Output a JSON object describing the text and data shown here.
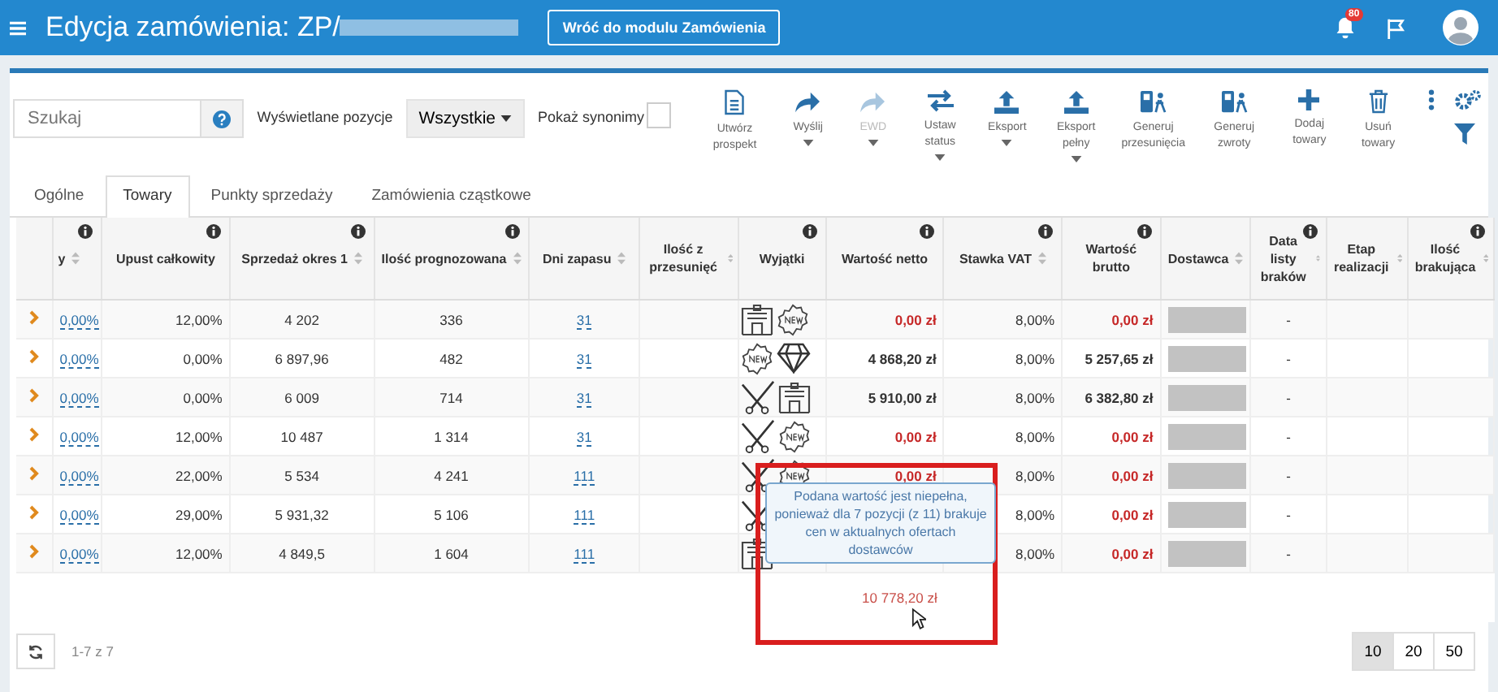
{
  "header": {
    "title": "Edycja zamówienia: ZP/",
    "back_button": "Wróć do modulu Zamówienia",
    "notification_count": "80"
  },
  "search": {
    "placeholder": "Szukaj"
  },
  "filter": {
    "label": "Wyświetlane pozycje",
    "value": "Wszystkie"
  },
  "synonyms": {
    "label": "Pokaż synonimy",
    "checked": false
  },
  "toolbar": [
    {
      "kind": "document",
      "label": "Utwórz prospekt",
      "disabled": false,
      "menu": false
    },
    {
      "kind": "forward",
      "label": "Wyślij",
      "disabled": false,
      "menu": true
    },
    {
      "kind": "forward",
      "label": "EWD",
      "disabled": true,
      "menu": true
    },
    {
      "kind": "swap",
      "label": "Ustaw status",
      "disabled": false,
      "menu": true
    },
    {
      "kind": "upload",
      "label": "Eksport",
      "disabled": false,
      "menu": true
    },
    {
      "kind": "upload",
      "label": "Eksport pełny",
      "disabled": false,
      "menu": true
    },
    {
      "kind": "transfer",
      "label": "Generuj przesunięcia",
      "disabled": false,
      "menu": false
    },
    {
      "kind": "transfer",
      "label": "Generuj zwroty",
      "disabled": false,
      "menu": false
    },
    {
      "kind": "plus",
      "label": "Dodaj towary",
      "disabled": false,
      "menu": false
    },
    {
      "kind": "trash",
      "label": "Usuń towary",
      "disabled": false,
      "menu": false
    }
  ],
  "tabs": [
    {
      "label": "Ogólne",
      "selected": false
    },
    {
      "label": "Towary",
      "selected": true
    },
    {
      "label": "Punkty sprzedaży",
      "selected": false
    },
    {
      "label": "Zamówienia cząstkowe",
      "selected": false
    }
  ],
  "table": {
    "columns": [
      {
        "info": false,
        "sort": false
      },
      {
        "label": "y",
        "info": true,
        "sort": true
      },
      {
        "label": "Upust całkowity",
        "info": true,
        "sort": false
      },
      {
        "label": "Sprzedaż okres 1",
        "info": true,
        "sort": true
      },
      {
        "label": "Ilość prognozowana",
        "info": true,
        "sort": true
      },
      {
        "label": "Dni zapasu",
        "info": false,
        "sort": true
      },
      {
        "label": "Ilość z przesunięć",
        "info": false,
        "sort": true
      },
      {
        "label": "Wyjątki",
        "info": true,
        "sort": false
      },
      {
        "label": "Wartość netto",
        "info": true,
        "sort": false
      },
      {
        "label": "Stawka VAT",
        "info": true,
        "sort": true
      },
      {
        "label": "Wartość brutto",
        "info": true,
        "sort": false
      },
      {
        "label": "Dostawca",
        "info": false,
        "sort": true
      },
      {
        "label": "Data listy braków",
        "info": true,
        "sort": true
      },
      {
        "label": "Etap realizacji",
        "info": false,
        "sort": true
      },
      {
        "label": "Ilość brakująca",
        "info": true,
        "sort": true
      }
    ],
    "rows": [
      {
        "discount": "0,00%",
        "total_discount": "12,00%",
        "sales": "4 202",
        "forecast": "336",
        "stock_days": "31",
        "exceptions": [
          {
            "kind": "warehouse"
          },
          {
            "kind": "new"
          }
        ],
        "net": "0,00 zł",
        "missing_price": true,
        "vat": "8,00%",
        "gross": "0,00 zł",
        "shortage_date": "-"
      },
      {
        "discount": "0,00%",
        "total_discount": "0,00%",
        "sales": "6 897,96",
        "forecast": "482",
        "stock_days": "31",
        "exceptions": [
          {
            "kind": "new"
          },
          {
            "kind": "diamond"
          }
        ],
        "net": "4 868,20 zł",
        "missing_price": false,
        "vat": "8,00%",
        "gross": "5 257,65 zł",
        "shortage_date": "-"
      },
      {
        "discount": "0,00%",
        "total_discount": "0,00%",
        "sales": "6 009",
        "forecast": "714",
        "stock_days": "31",
        "exceptions": [
          {
            "kind": "scissors"
          },
          {
            "kind": "warehouse"
          }
        ],
        "net": "5 910,00 zł",
        "missing_price": false,
        "vat": "8,00%",
        "gross": "6 382,80 zł",
        "shortage_date": "-"
      },
      {
        "discount": "0,00%",
        "total_discount": "12,00%",
        "sales": "10 487",
        "forecast": "1 314",
        "stock_days": "31",
        "exceptions": [
          {
            "kind": "scissors"
          },
          {
            "kind": "new"
          }
        ],
        "net": "0,00 zł",
        "missing_price": true,
        "vat": "8,00%",
        "gross": "0,00 zł",
        "shortage_date": "-"
      },
      {
        "discount": "0,00%",
        "total_discount": "22,00%",
        "sales": "5 534",
        "forecast": "4 241",
        "stock_days": "111",
        "exceptions": [
          {
            "kind": "scissors"
          },
          {
            "kind": "new"
          }
        ],
        "net": "0,00 zł",
        "missing_price": true,
        "vat": "8,00%",
        "gross": "0,00 zł",
        "shortage_date": "-"
      },
      {
        "discount": "0,00%",
        "total_discount": "29,00%",
        "sales": "5 931,32",
        "forecast": "5 106",
        "stock_days": "111",
        "exceptions": [
          {
            "kind": "scissors"
          }
        ],
        "missing_price": true,
        "vat": "8,00%",
        "gross": "0,00 zł",
        "shortage_date": "-"
      },
      {
        "discount": "0,00%",
        "total_discount": "12,00%",
        "sales": "4 849,5",
        "forecast": "1 604",
        "stock_days": "111",
        "exceptions": [
          {
            "kind": "warehouse"
          }
        ],
        "missing_price": true,
        "vat": "8,00%",
        "gross": "0,00 zł",
        "shortage_date": "-"
      }
    ],
    "total_net": "10 778,20 zł"
  },
  "tooltip": "Podana wartość jest niepełna, ponieważ dla 7 pozycji (z 11) brakuje cen w aktualnych ofertach dostawców",
  "footer": {
    "range": "1-7 z 7",
    "page_sizes": [
      {
        "label": "10",
        "selected": true
      },
      {
        "label": "20",
        "selected": false
      },
      {
        "label": "50",
        "selected": false
      }
    ]
  }
}
